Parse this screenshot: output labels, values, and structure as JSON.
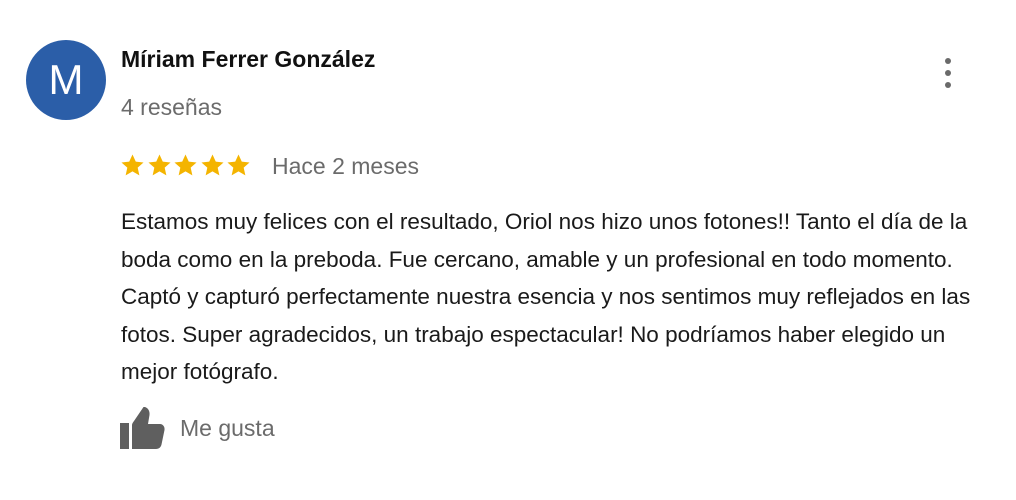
{
  "review": {
    "avatar_letter": "M",
    "avatar_color": "#2b5ea8",
    "author_name": "Míriam Ferrer González",
    "review_count": "4 reseñas",
    "rating": 5,
    "rating_max": 5,
    "star_color": "#f4b400",
    "date": "Hace 2 meses",
    "text": "Estamos muy felices con el resultado, Oriol nos hizo unos fotones!! Tanto el día de la boda como en la preboda. Fue cercano, amable y un profesional en todo momento. Captó y capturó perfectamente nuestra esencia y nos sentimos muy reflejados en las fotos. Super agradecidos, un trabajo espectacular! No podríamos haber elegido un mejor fotógrafo.",
    "like_label": "Me gusta",
    "icons": {
      "more": "more-vert-icon",
      "star": "star-icon",
      "like": "thumbs-up-icon"
    }
  }
}
